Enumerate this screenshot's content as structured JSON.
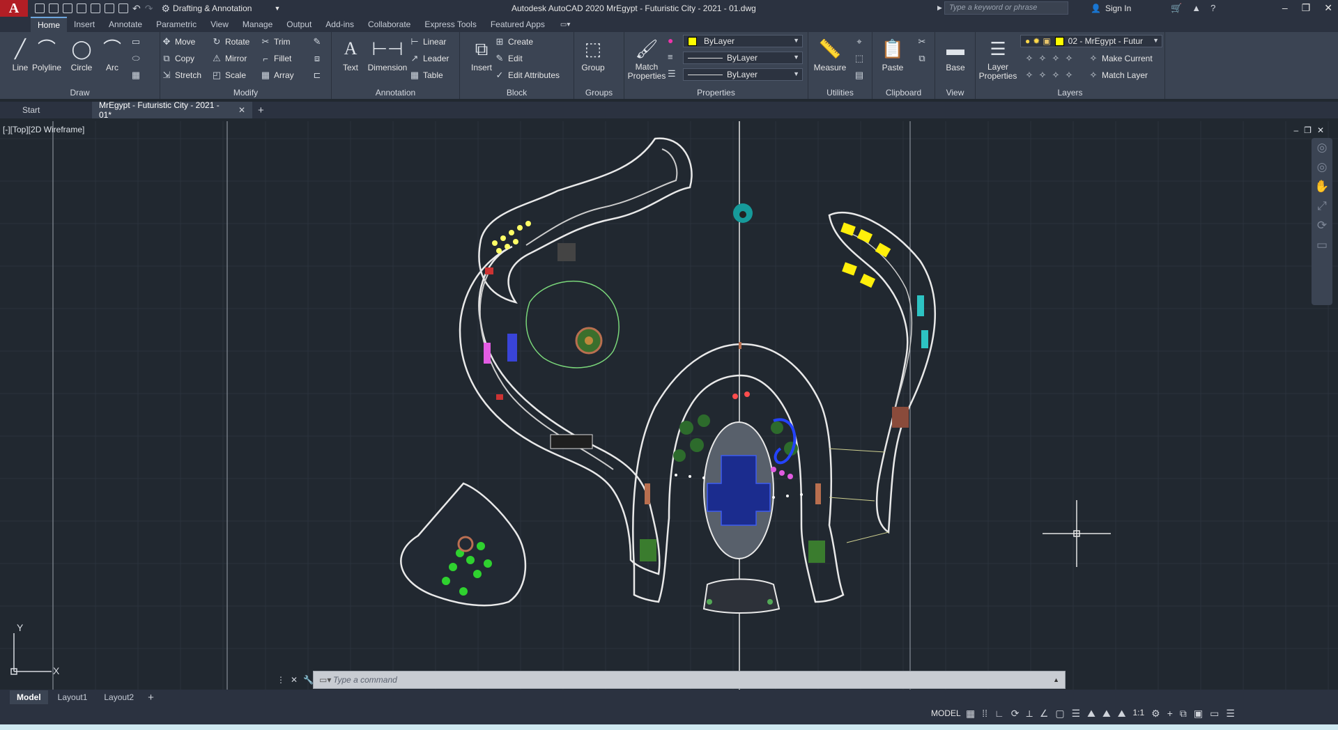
{
  "titlebar": {
    "workspace": "Drafting & Annotation",
    "title": "Autodesk AutoCAD 2020   MrEgypt - Futuristic City - 2021 - 01.dwg",
    "search_placeholder": "Type a keyword or phrase",
    "signin": "Sign In"
  },
  "tabs": [
    "Home",
    "Insert",
    "Annotate",
    "Parametric",
    "View",
    "Manage",
    "Output",
    "Add-ins",
    "Collaborate",
    "Express Tools",
    "Featured Apps"
  ],
  "ribbon": {
    "draw": {
      "title": "Draw",
      "line": "Line",
      "polyline": "Polyline",
      "circle": "Circle",
      "arc": "Arc"
    },
    "modify": {
      "title": "Modify",
      "move": "Move",
      "rotate": "Rotate",
      "trim": "Trim",
      "copy": "Copy",
      "mirror": "Mirror",
      "fillet": "Fillet",
      "stretch": "Stretch",
      "scale": "Scale",
      "array": "Array"
    },
    "annotation": {
      "title": "Annotation",
      "text": "Text",
      "dimension": "Dimension",
      "linear": "Linear",
      "leader": "Leader",
      "table": "Table"
    },
    "block": {
      "title": "Block",
      "insert": "Insert",
      "create": "Create",
      "edit": "Edit",
      "edit_attributes": "Edit Attributes"
    },
    "groups": {
      "title": "Groups",
      "group": "Group"
    },
    "properties": {
      "title": "Properties",
      "match": "Match Properties",
      "color": "ByLayer",
      "linetype": "ByLayer",
      "lineweight": "ByLayer"
    },
    "utilities": {
      "title": "Utilities",
      "measure": "Measure"
    },
    "clipboard": {
      "title": "Clipboard",
      "paste": "Paste"
    },
    "view": {
      "title": "View",
      "base": "Base"
    },
    "layers": {
      "title": "Layers",
      "layer_properties": "Layer Properties",
      "current_layer": "02 - MrEgypt - Futur",
      "make_current": "Make Current",
      "match_layer": "Match Layer"
    }
  },
  "file_tabs": {
    "start": "Start",
    "drawing": "MrEgypt - Futuristic City - 2021 - 01*"
  },
  "viewport": {
    "label": "[-][Top][2D Wireframe]",
    "ucs_x": "X",
    "ucs_y": "Y"
  },
  "command": {
    "placeholder": "Type a command"
  },
  "layout_tabs": [
    "Model",
    "Layout1",
    "Layout2"
  ],
  "status": {
    "model": "MODEL",
    "scale": "1:1"
  },
  "colors": {
    "ribbon": "#3b4453",
    "canvas": "#212830",
    "titlebar": "#2b3240",
    "accent": "#6ea7e0",
    "brand": "#b21e25"
  }
}
